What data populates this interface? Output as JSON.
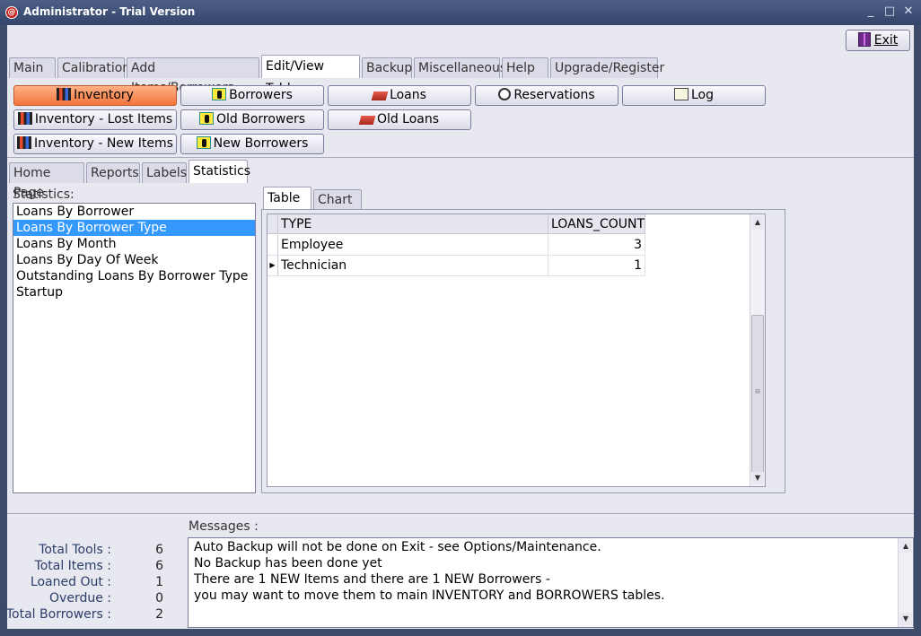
{
  "window": {
    "title": "Administrator - Trial Version",
    "icon": "app-icon",
    "controls": [
      "_",
      "□",
      "✕"
    ]
  },
  "toolbar": {
    "exit_label": "Exit"
  },
  "main_tabs": [
    {
      "label": "Main"
    },
    {
      "label": "Calibration"
    },
    {
      "label": "Add Items/Borrowers"
    },
    {
      "label": "Edit/View Table",
      "active": true
    },
    {
      "label": "Backup"
    },
    {
      "label": "Miscellaneous"
    },
    {
      "label": "Help"
    },
    {
      "label": "Upgrade/Register"
    }
  ],
  "table_buttons": [
    {
      "label": "Inventory",
      "icon": "bars-icon",
      "active": true
    },
    {
      "label": "Borrowers",
      "icon": "person-icon"
    },
    {
      "label": "Loans",
      "icon": "loans-icon"
    },
    {
      "label": "Reservations",
      "icon": "clock-icon"
    },
    {
      "label": "Log",
      "icon": "log-icon"
    },
    {
      "label": "Inventory - Lost Items",
      "icon": "bars-icon"
    },
    {
      "label": "Old Borrowers",
      "icon": "person-icon"
    },
    {
      "label": "Old Loans",
      "icon": "loans-icon"
    },
    {
      "label": "Inventory - New Items",
      "icon": "bars-icon"
    },
    {
      "label": "New Borrowers",
      "icon": "person-icon"
    }
  ],
  "sub_tabs": [
    {
      "label": "Home Page"
    },
    {
      "label": "Reports"
    },
    {
      "label": "Labels"
    },
    {
      "label": "Statistics",
      "active": true
    }
  ],
  "statistics": {
    "label": "Statistics:",
    "items": [
      "Loans By Borrower",
      "Loans By Borrower Type",
      "Loans By Month",
      "Loans By Day Of Week",
      "Outstanding Loans By Borrower Type",
      "Startup"
    ],
    "selected_index": 1
  },
  "view_tabs": [
    {
      "label": "Table",
      "active": true
    },
    {
      "label": "Chart"
    }
  ],
  "grid": {
    "columns": [
      "TYPE",
      "LOANS_COUNT"
    ],
    "rows": [
      [
        "Employee",
        "3"
      ],
      [
        "Technician",
        "1"
      ]
    ],
    "current_row_index": 1
  },
  "summary": {
    "messages_label": "Messages :",
    "stats": [
      {
        "label": "Total Tools :",
        "value": "6"
      },
      {
        "label": "Total Items :",
        "value": "6"
      },
      {
        "label": "Loaned Out :",
        "value": "1"
      },
      {
        "label": "Overdue :",
        "value": "0"
      },
      {
        "label": "Total Borrowers :",
        "value": "2"
      }
    ],
    "messages": [
      "Auto Backup will not be done on Exit - see Options/Maintenance.",
      "No Backup has been done yet",
      "There are 1 NEW Items and there are 1 NEW Borrowers -",
      "you may want to move them to main INVENTORY and BORROWERS tables."
    ]
  },
  "colors": {
    "titlebar": "#3b4b69",
    "panel": "#e8e8f0",
    "active_button": "#f3743d",
    "selection": "#3399ff"
  }
}
